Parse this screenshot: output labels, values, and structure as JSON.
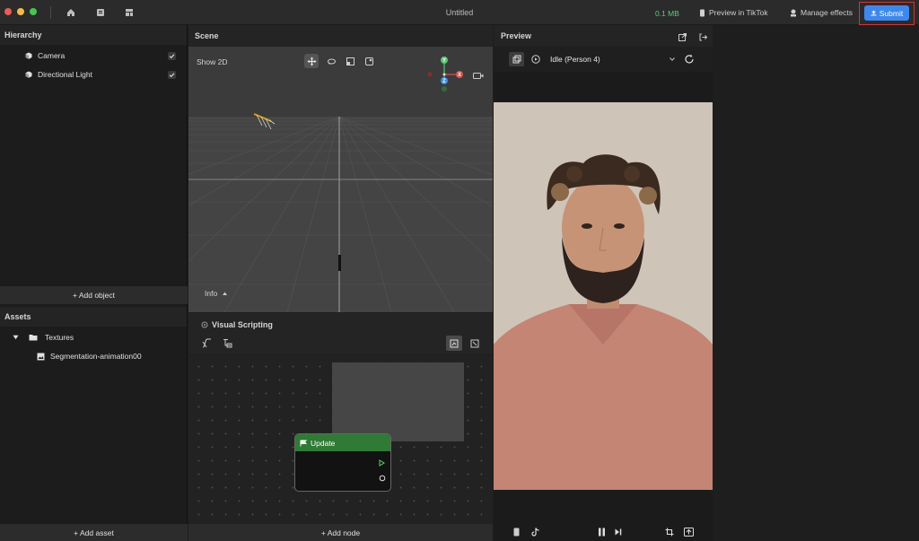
{
  "app": {
    "title": "Untitled",
    "size": "0.1 MB",
    "preview_tiktok": "Preview in TikTok",
    "manage_effects": "Manage effects",
    "submit": "Submit"
  },
  "hierarchy": {
    "title": "Hierarchy",
    "items": [
      {
        "label": "Camera",
        "checked": true,
        "icon": "cube-icon"
      },
      {
        "label": "Directional Light",
        "checked": true,
        "icon": "cube-icon"
      }
    ],
    "add_object": "+ Add object"
  },
  "assets": {
    "title": "Assets",
    "folder": "Textures",
    "file": "Segmentation-animation00",
    "add_asset": "+ Add asset"
  },
  "scene": {
    "title": "Scene",
    "show2d": "Show 2D",
    "info": "Info",
    "axes": {
      "x": "X",
      "y": "Y",
      "z": "Z"
    }
  },
  "visual_scripting": {
    "title": "Visual Scripting",
    "node_label": "Update",
    "add_node": "+ Add node"
  },
  "preview": {
    "title": "Preview",
    "selected_option": "Idle (Person 4)"
  },
  "colors": {
    "accent": "#3d88f0",
    "node_header": "#2f7a35",
    "size_text": "#4fd27b",
    "highlight_border": "#d9352b"
  }
}
